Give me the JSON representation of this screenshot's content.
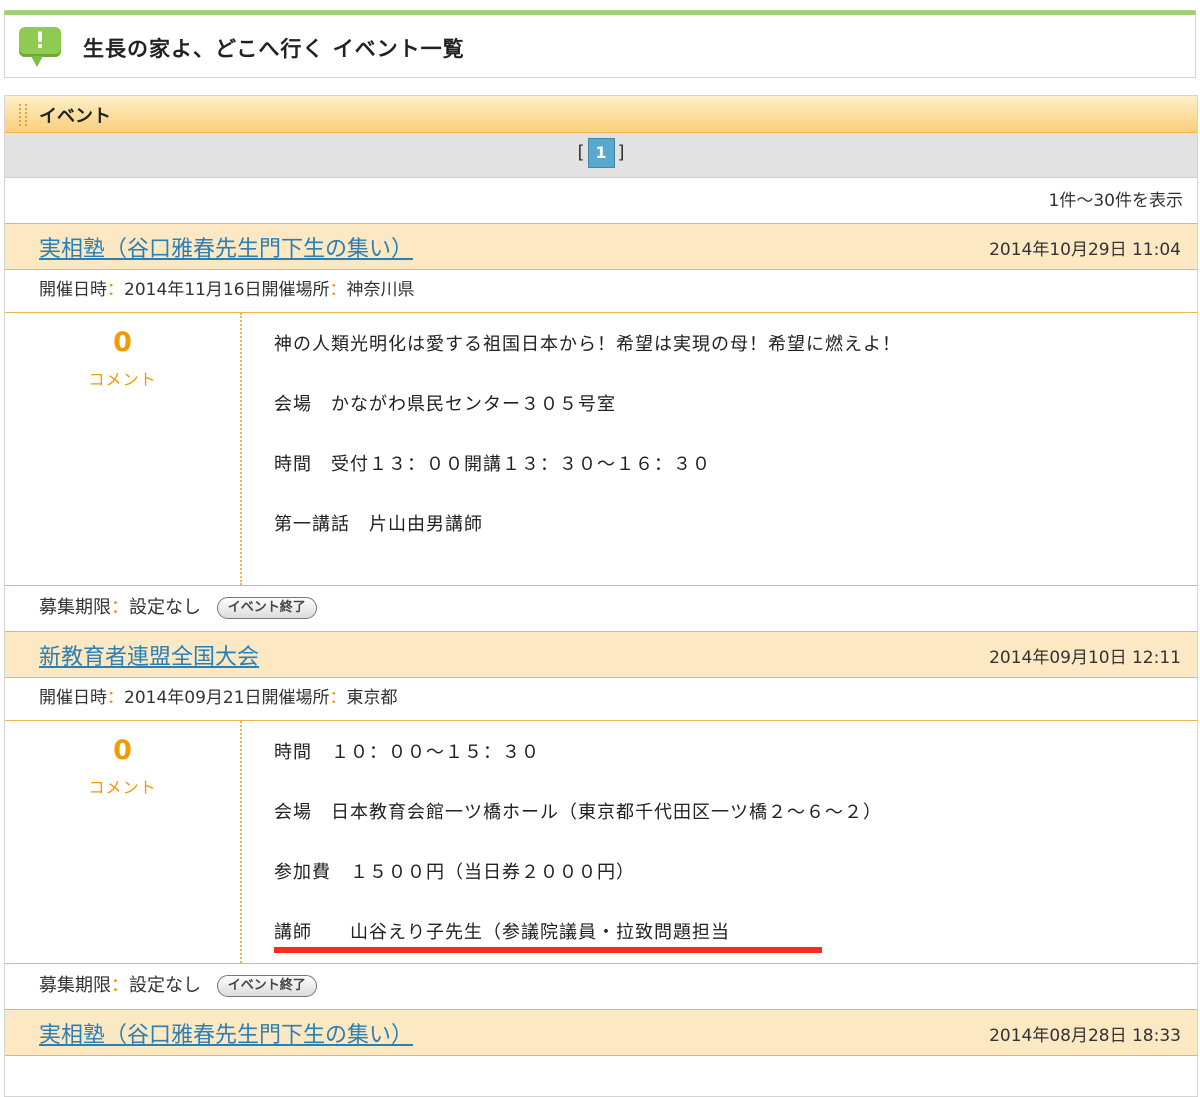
{
  "page": {
    "title": "生長の家よ、どこへ行く イベント一覧",
    "icon": "exclamation-icon"
  },
  "section": {
    "title": "イベント",
    "pager": {
      "left": "[",
      "current": "1",
      "right": "]"
    },
    "count_text": "1件～30件を表示"
  },
  "events": [
    {
      "title": "実相塾（谷口雅春先生門下生の集い）",
      "posted": "2014年10月29日 11:04",
      "date_label": "開催日時",
      "date_value": "2014年11月16日",
      "place_label": "開催場所",
      "place_value": "神奈川県",
      "comment_count": "0",
      "comment_label": "コメント",
      "lines": [
        "神の人類光明化は愛する祖国日本から！希望は実現の母！希望に燃えよ！",
        "会場　かながわ県民センター３０５号室",
        "時間　受付１３：００開講１３：３０～１６：３０",
        "第一講話　片山由男講師"
      ],
      "deadline_label": "募集期限",
      "deadline_value": "設定なし",
      "status": "イベント終了"
    },
    {
      "title": "新教育者連盟全国大会",
      "posted": "2014年09月10日 12:11",
      "date_label": "開催日時",
      "date_value": "2014年09月21日",
      "place_label": "開催場所",
      "place_value": "東京都",
      "comment_count": "0",
      "comment_label": "コメント",
      "lines": [
        "時間　１０：００～１５：３０",
        "会場　日本教育会館一ツ橋ホール（東京都千代田区一ツ橋２～６～２）",
        "参加費　１５００円（当日券２０００円）",
        "講師　　山谷えり子先生（参議院議員・拉致問題担当"
      ],
      "deadline_label": "募集期限",
      "deadline_value": "設定なし",
      "status": "イベント終了"
    },
    {
      "title": "実相塾（谷口雅春先生門下生の集い）",
      "posted": "2014年08月28日 18:33"
    }
  ],
  "colors": {
    "accent_orange": "#f29a00",
    "link_blue": "#2a7fb3",
    "highlight_red": "#ff2a1a",
    "header_green": "#8fca52"
  }
}
